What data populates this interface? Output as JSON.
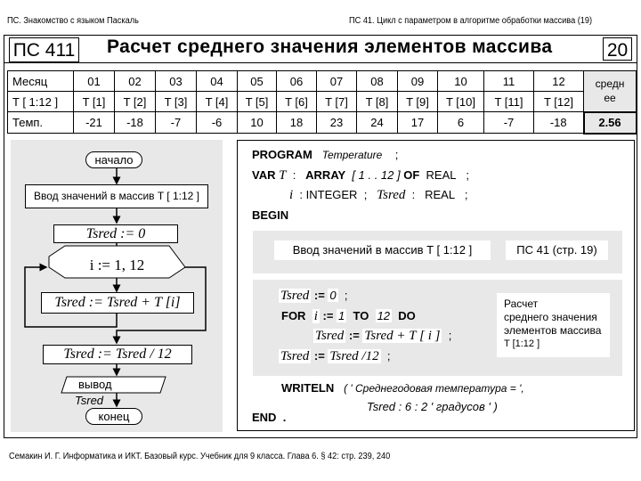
{
  "header": {
    "left": "ПС. Знакомство с языком Паскаль",
    "right": "ПС 41. Цикл с параметром в алгоритме обработки массива (19)"
  },
  "slide": {
    "code_badge": "ПС 411",
    "title": "Расчет среднего значения элементов массива",
    "page_number": "20"
  },
  "table": {
    "row_labels": [
      "Месяц",
      "T [ 1:12 ]",
      "Темп."
    ],
    "months": [
      "01",
      "02",
      "03",
      "04",
      "05",
      "06",
      "07",
      "08",
      "09",
      "10",
      "11",
      "12"
    ],
    "elements": [
      "T [1]",
      "T [2]",
      "T [3]",
      "T [4]",
      "T [5]",
      "T [6]",
      "T [7]",
      "T [8]",
      "T [9]",
      "T [10]",
      "T [11]",
      "T [12]"
    ],
    "temps": [
      "-21",
      "-18",
      "-7",
      "-6",
      "10",
      "18",
      "23",
      "24",
      "17",
      "6",
      "-7",
      "-18"
    ],
    "average_label_1": "средн",
    "average_label_2": "ее",
    "average_value": "2.56"
  },
  "flowchart": {
    "start": "начало",
    "input": "Ввод значений в массив T [ 1:12 ]",
    "init": "Tsred := 0",
    "loop": "i := 1, 12",
    "body": "Tsred := Tsred + T [i]",
    "divide": "Tsred := Tsred / 12",
    "output_1": "вывод",
    "output_2": "Tsred",
    "end": "конец"
  },
  "code": {
    "program_kw": "PROGRAM",
    "program_name": "Temperature",
    "semicolon": ";",
    "var_kw": "VAR",
    "var_t": "T",
    "colon": ":",
    "array_kw": "ARRAY",
    "range": "[ 1 . . 12 ]",
    "of_kw": "OF",
    "real": "REAL",
    "var_i": "i",
    "integer": "INTEGER",
    "tsred": "Tsred",
    "begin_kw": "BEGIN",
    "input_comment": "Ввод значений в массив T [ 1:12 ]",
    "input_ref": "ПС 41 (стр. 19)",
    "assign": ":=",
    "zero": "0",
    "for_kw": "FOR",
    "one": "1",
    "to_kw": "TO",
    "twelve": "12",
    "do_kw": "DO",
    "sum_expr": "Tsred + T [ i ]",
    "div_expr": "Tsred /12",
    "calc_comment": [
      "Расчет",
      "среднего значения",
      "элементов массива",
      "T [1:12 ]"
    ],
    "writeln_kw": "WRITELN",
    "writeln_arg1": "( ' Среднегодовая температура =  ',",
    "writeln_arg2": "Tsred : 6 : 2   '  градусов  '  )",
    "end_kw": "END",
    "dot": "."
  },
  "footer": "Семакин И. Г. Информатика и ИКТ. Базовый курс. Учебник для 9 класса. Глава 6. § 42: стр. 239, 240"
}
